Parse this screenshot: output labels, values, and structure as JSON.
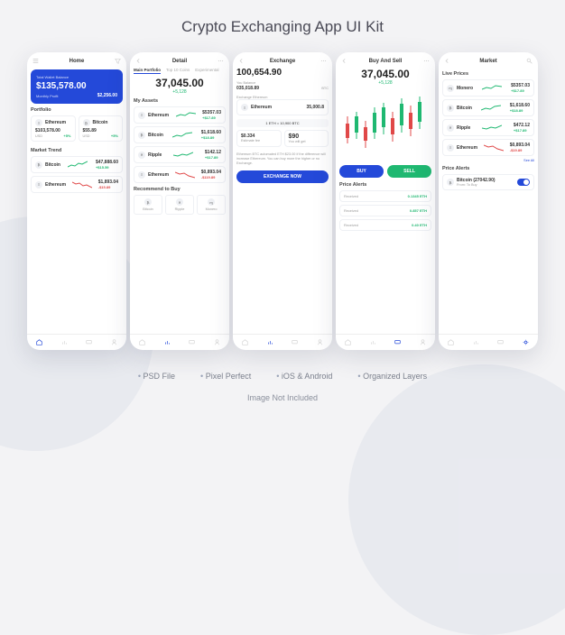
{
  "title": "Crypto Exchanging App UI Kit",
  "features": [
    "PSD File",
    "Pixel Perfect",
    "iOS & Android",
    "Organized Layers"
  ],
  "footer": "Image Not Included",
  "screens": {
    "home": {
      "title": "Home",
      "wallet_label": "Total Wallet Balance",
      "wallet_value": "$135,578.00",
      "monthly_label": "Monthly Profit",
      "monthly_value": "$2,256.00",
      "section_portfolio": "Portfolio",
      "portfolio": [
        {
          "name": "Ethereum",
          "value": "$103,578.00",
          "change": "+5%"
        },
        {
          "name": "Bitcoin",
          "value": "$55.89",
          "change": "+5%"
        }
      ],
      "sub": "USD",
      "section_trend": "Market Trend",
      "trend": [
        {
          "name": "Bitcoin",
          "value": "$47,888.60",
          "change": "+$15.59"
        },
        {
          "name": "Ethereum",
          "value": "$1,893.04",
          "change": "-$15.89"
        }
      ]
    },
    "detail": {
      "title": "Detail",
      "tabs": [
        "Main Portfolio",
        "Top 10 Coins",
        "Experimental"
      ],
      "value": "37,045.00",
      "change": "+5,128",
      "section_assets": "My Assets",
      "assets": [
        {
          "name": "Ethereum",
          "value": "$5357.03",
          "change": "+$17.89"
        },
        {
          "name": "Bitcoin",
          "value": "$1,618.60",
          "change": "+$18.89"
        },
        {
          "name": "Ripple",
          "value": "$142.12",
          "change": "+$17.89"
        },
        {
          "name": "Ethereum",
          "value": "$0,893.04",
          "change": "-$119.89"
        }
      ],
      "section_rec": "Recommend to Buy",
      "rec": [
        "Bitcoin",
        "Ripple",
        "Monero"
      ]
    },
    "exchange": {
      "title": "Exchange",
      "value": "100,654.90",
      "you_balance": "You Balance",
      "bal": "035,018.89",
      "bal_c": "BTC",
      "ex_label": "Exchange Ethereum",
      "coin": "Ethereum",
      "amount": "35,000.8",
      "rate": "1 ETH = 10,900 BTC",
      "fee_label": "Estimate fee",
      "fee": "$0.334",
      "get_label": "You will get",
      "get": "$90",
      "note": "Ethereum BTC automated ETH $23.00 if the difference will increase Ethereum. You can buy more the higher or no Exchange.",
      "btn": "EXCHANGE NOW"
    },
    "buysell": {
      "title": "Buy And Sell",
      "value": "37,045.00",
      "change": "+5,128",
      "buy": "BUY",
      "sell": "SELL",
      "section_alerts": "Price Alerts",
      "alerts": [
        {
          "label": "Received",
          "value": "0.1345 ETH"
        },
        {
          "label": "Received",
          "value": "0.857 ETH"
        },
        {
          "label": "Received",
          "value": "0.40 ETH"
        }
      ]
    },
    "market": {
      "title": "Market",
      "section_live": "Live Prices",
      "prices": [
        {
          "name": "Monero",
          "value": "$5357.03",
          "change": "+$17.89"
        },
        {
          "name": "Bitcoin",
          "value": "$1,618.60",
          "change": "+$18.89"
        },
        {
          "name": "Ripple",
          "value": "$472.12",
          "change": "+$17.89"
        },
        {
          "name": "Ethereum",
          "value": "$0,893.04",
          "change": "-$19.89"
        }
      ],
      "see_all": "See All",
      "section_alerts": "Price Alerts",
      "alert": {
        "name": "Bitcoin (27042.90)",
        "sub": "From: To Buy"
      }
    }
  }
}
